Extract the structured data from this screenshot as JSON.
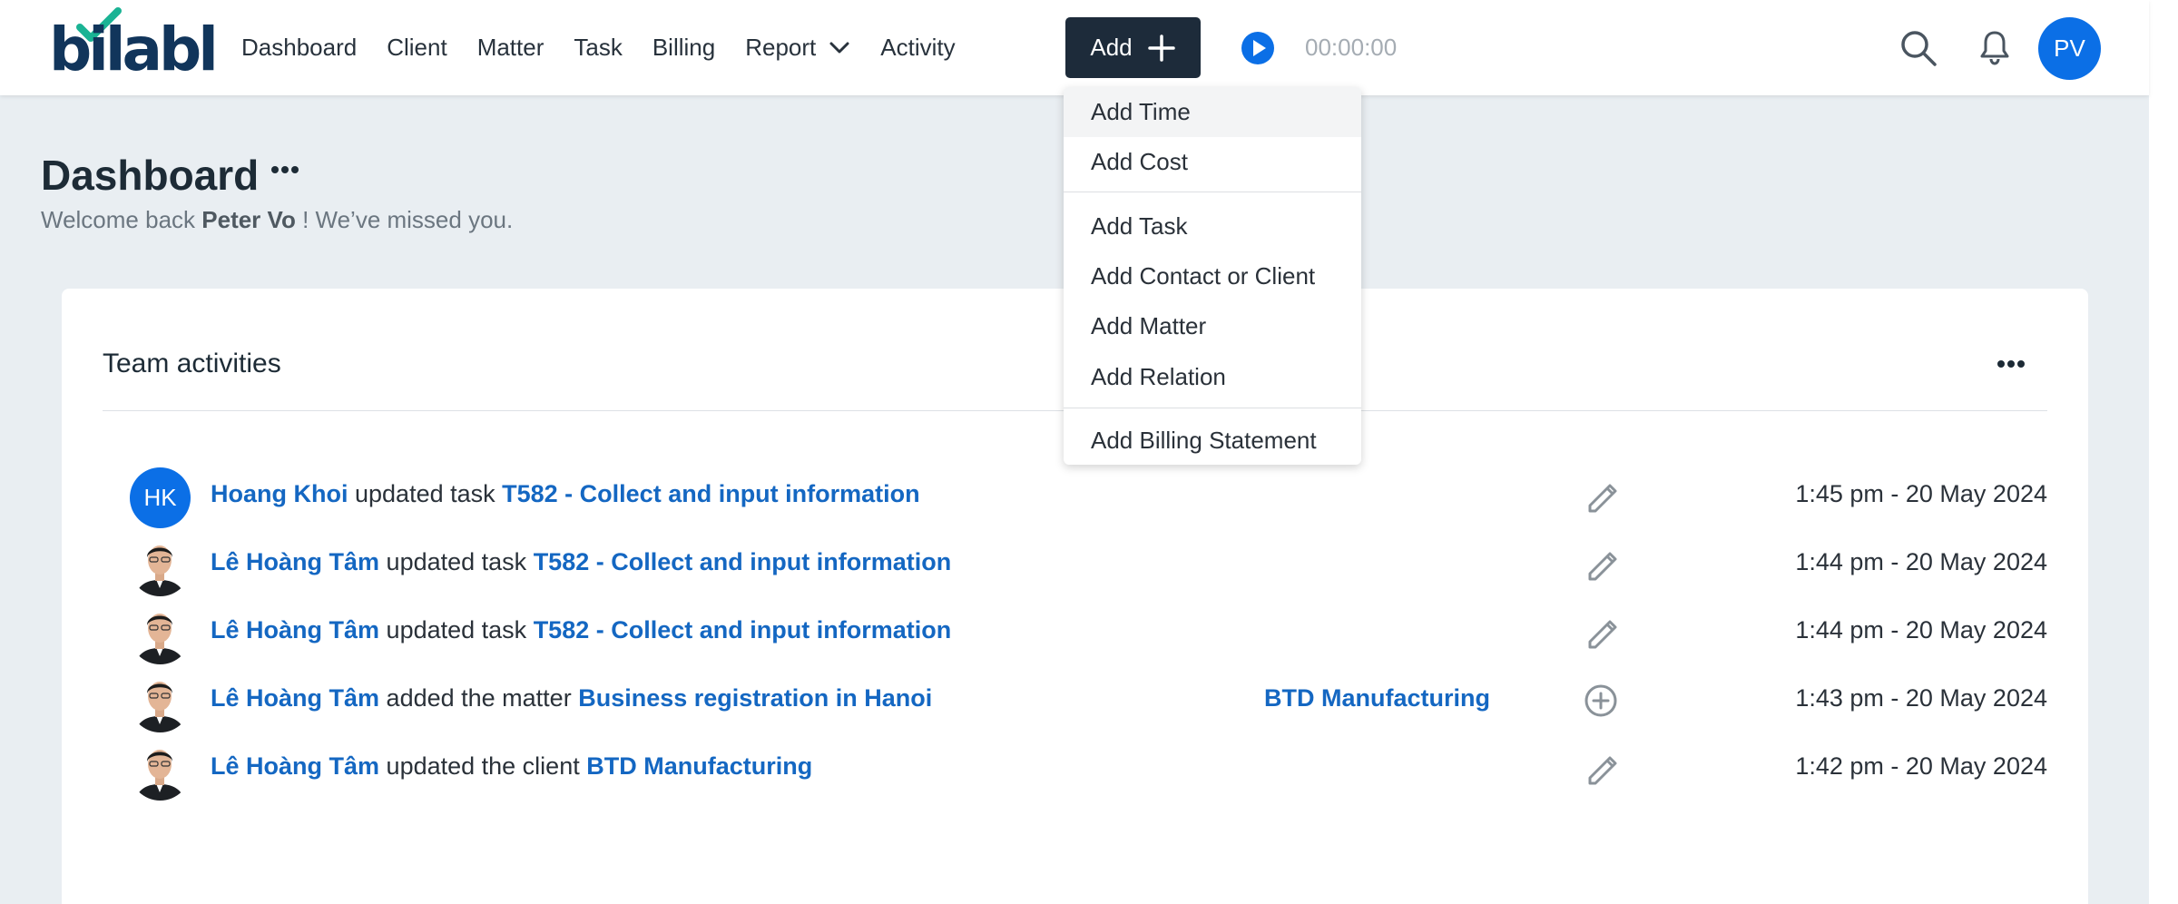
{
  "app": {
    "logo_text": "bilabl",
    "accent_color": "#0b6fe6",
    "logo_check_color": "#1ab394"
  },
  "nav": {
    "items": [
      {
        "label": "Dashboard"
      },
      {
        "label": "Client"
      },
      {
        "label": "Matter"
      },
      {
        "label": "Task"
      },
      {
        "label": "Billing"
      },
      {
        "label": "Report",
        "has_dropdown": true
      },
      {
        "label": "Activity"
      }
    ],
    "add_label": "Add",
    "timer": "00:00:00",
    "user_initials": "PV"
  },
  "add_menu": {
    "items": [
      {
        "label": "Add Time",
        "highlighted": true
      },
      {
        "label": "Add Cost"
      },
      {
        "label": "Add Task"
      },
      {
        "label": "Add Contact or Client"
      },
      {
        "label": "Add Matter"
      },
      {
        "label": "Add Relation"
      },
      {
        "label": "Add Billing Statement"
      }
    ]
  },
  "page": {
    "title": "Dashboard",
    "welcome_prefix": "Welcome back",
    "user_name": "Peter Vo",
    "welcome_suffix": "! We’ve missed you."
  },
  "team_activities": {
    "title": "Team activities",
    "rows": [
      {
        "avatar": "HK",
        "actor": "Hoang Khoi",
        "action": "updated task",
        "target": "T582 - Collect and input information",
        "client": "",
        "icon": "pencil-icon",
        "time": "1:45 pm - 20 May 2024"
      },
      {
        "avatar": "photo",
        "actor": "Lê Hoàng Tâm",
        "action": "updated task",
        "target": "T582 - Collect and input information",
        "client": "",
        "icon": "pencil-icon",
        "time": "1:44 pm - 20 May 2024"
      },
      {
        "avatar": "photo",
        "actor": "Lê Hoàng Tâm",
        "action": "updated task",
        "target": "T582 - Collect and input information",
        "client": "",
        "icon": "pencil-icon",
        "time": "1:44 pm - 20 May 2024"
      },
      {
        "avatar": "photo",
        "actor": "Lê Hoàng Tâm",
        "action": "added the matter",
        "target": "Business registration in Hanoi",
        "client": "BTD Manufacturing",
        "icon": "plus-circle-icon",
        "time": "1:43 pm - 20 May 2024"
      },
      {
        "avatar": "photo",
        "actor": "Lê Hoàng Tâm",
        "action": "updated the client",
        "target": "BTD Manufacturing",
        "client": "",
        "icon": "pencil-icon",
        "time": "1:42 pm - 20 May 2024"
      }
    ]
  }
}
